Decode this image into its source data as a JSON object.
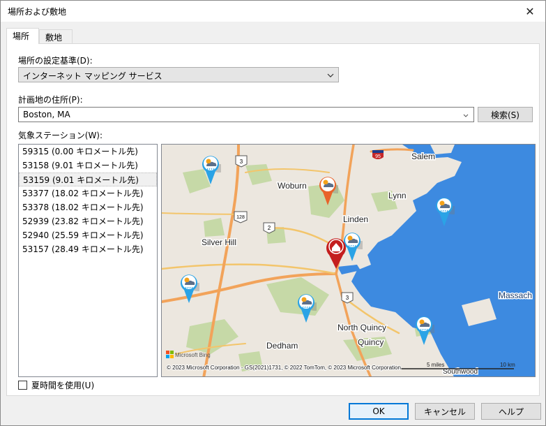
{
  "window": {
    "title": "場所および敷地",
    "close_glyph": "✕"
  },
  "tabs": [
    {
      "label": "場所"
    },
    {
      "label": "敷地"
    }
  ],
  "location_basis": {
    "label": "場所の設定基準(D):",
    "value": "インターネット マッピング サービス"
  },
  "address": {
    "label": "計画地の住所(P):",
    "value": "Boston, MA",
    "search_button": "検索(S)"
  },
  "stations": {
    "label": "気象ステーション(W):",
    "items": [
      "59315 (0.00 キロメートル先)",
      "53158 (9.01 キロメートル先)",
      "53159 (9.01 キロメートル先)",
      "53377 (18.02 キロメートル先)",
      "53378 (18.02 キロメートル先)",
      "52939 (23.82 キロメートル先)",
      "52940 (25.59 キロメートル先)",
      "53157 (28.49 キロメートル先)"
    ],
    "selected_index": 2
  },
  "map": {
    "places": {
      "salem": "Salem",
      "woburn": "Woburn",
      "lynn": "Lynn",
      "linden": "Linden",
      "silver_hill": "Silver Hill",
      "massach": "Massach",
      "north_quincy": "North Quincy",
      "quincy": "Quincy",
      "dedham": "Dedham",
      "southwood": "Southwood"
    },
    "road_shields": {
      "r3a": "3",
      "r95": "95",
      "r128": "128",
      "r2": "2",
      "r3b": "3"
    },
    "logo": "Microsoft Bing",
    "copyright": "© 2023 Microsoft Corporation - GS(2021)1731, © 2022 TomTom, © 2023 Microsoft Corporation",
    "scale_miles": "5 miles",
    "scale_km": "10 km",
    "colors": {
      "land": "#ece7df",
      "water": "#3d8ae0",
      "parks": "#c6d9a7",
      "road": "#f3c56b",
      "highway": "#f2a35a"
    }
  },
  "dst": {
    "label": "夏時間を使用(U)",
    "checked": false
  },
  "buttons": {
    "ok": "OK",
    "cancel": "キャンセル",
    "help": "ヘルプ"
  }
}
